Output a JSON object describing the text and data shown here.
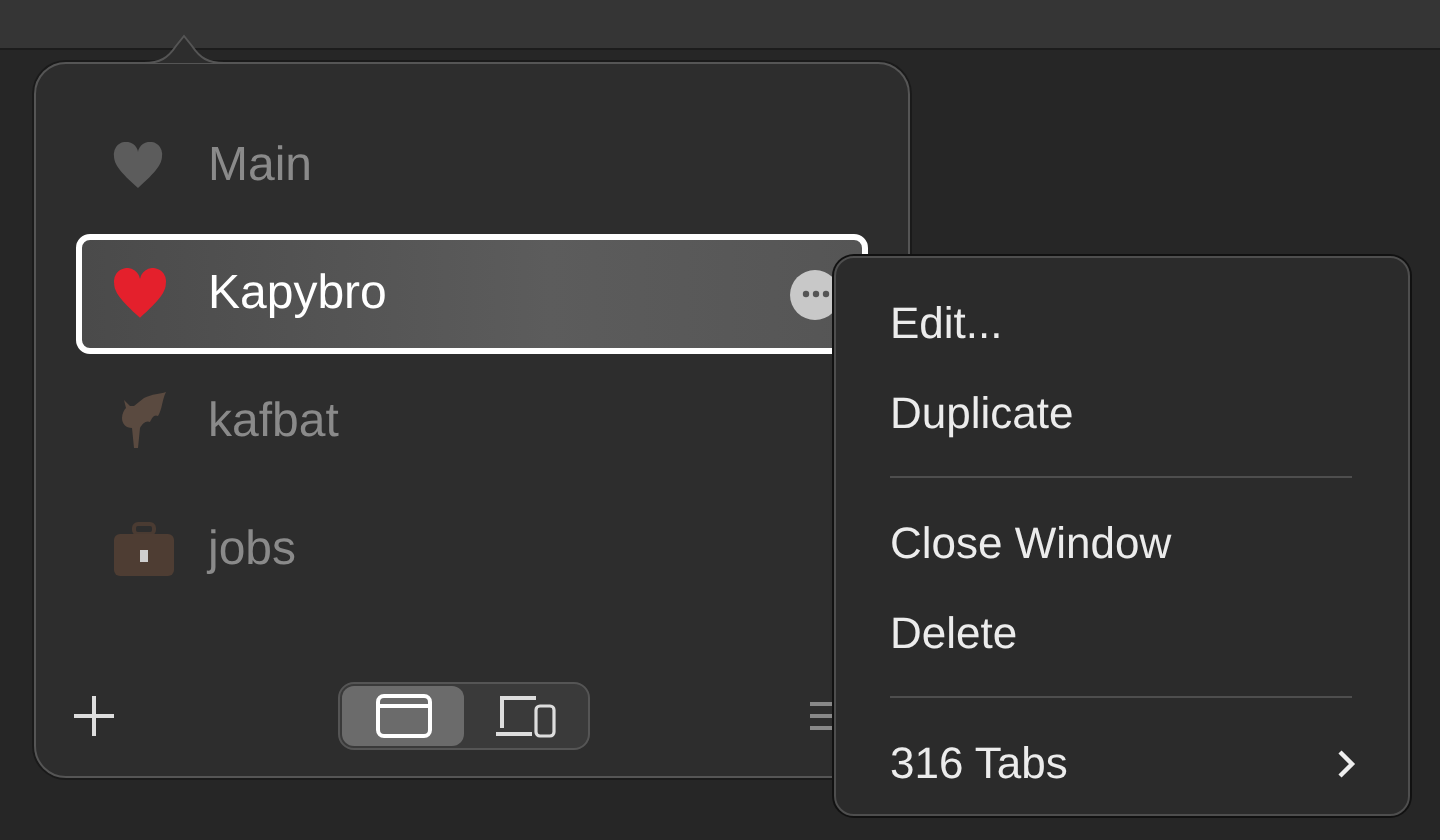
{
  "profiles": [
    {
      "name": "Main",
      "selected": false
    },
    {
      "name": "Kapybro",
      "selected": true
    },
    {
      "name": "kafbat",
      "selected": false
    },
    {
      "name": "jobs",
      "selected": false
    }
  ],
  "segments": [
    {
      "selected": true
    },
    {
      "selected": false
    }
  ],
  "context_menu": [
    {
      "kind": "item",
      "label": "Edit..."
    },
    {
      "kind": "item",
      "label": "Duplicate"
    },
    {
      "kind": "separator"
    },
    {
      "kind": "item",
      "label": "Close Window"
    },
    {
      "kind": "item",
      "label": "Delete"
    },
    {
      "kind": "separator"
    },
    {
      "kind": "submenu",
      "label": "316 Tabs"
    }
  ]
}
